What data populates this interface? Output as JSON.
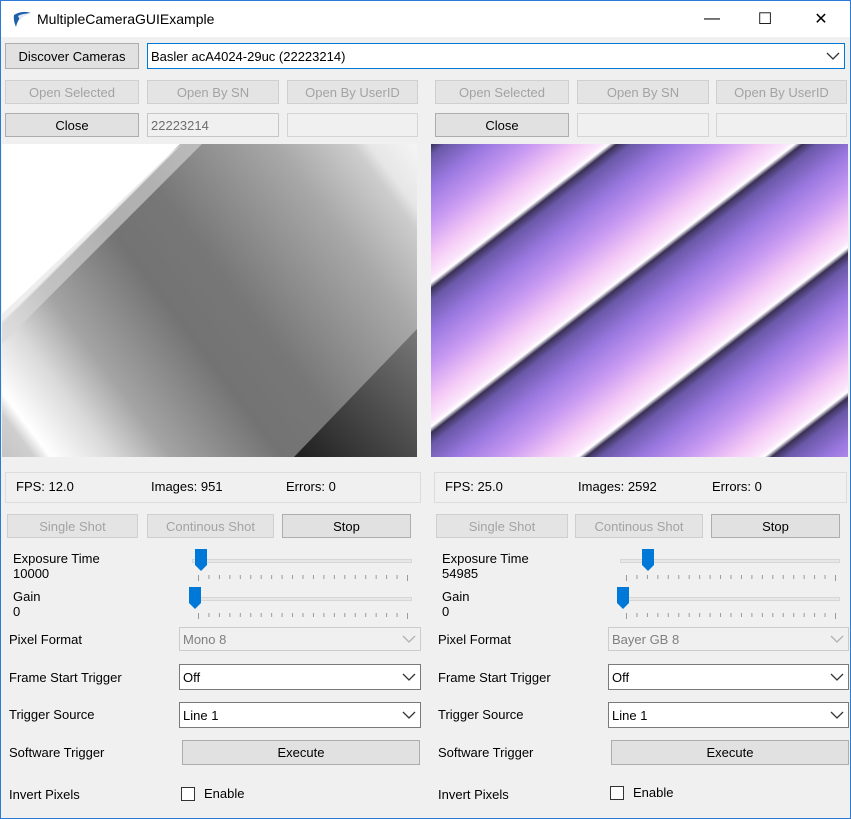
{
  "window": {
    "title": "MultipleCameraGUIExample",
    "controls": [
      "—",
      "☐",
      "✕"
    ]
  },
  "top": {
    "discover_label": "Discover Cameras",
    "camera_selected": "Basler acA4024-29uc (22223214)"
  },
  "cameras": [
    {
      "open_selected": "Open Selected",
      "open_by_sn": "Open By SN",
      "open_by_userid": "Open By UserID",
      "close": "Close",
      "sn_value": "22223214",
      "userid_value": "",
      "fps": "FPS: 12.0",
      "images": "Images: 951",
      "errors": "Errors: 0",
      "single_shot": "Single Shot",
      "continuous_shot": "Continous Shot",
      "stop": "Stop",
      "exposure_label": "Exposure Time",
      "exposure_value": "10000",
      "exposure_level": 0.03,
      "gain_label": "Gain",
      "gain_value": "0",
      "gain_level": 0.0,
      "pixel_format_label": "Pixel Format",
      "pixel_format_value": "Mono 8",
      "frame_start_label": "Frame Start Trigger",
      "frame_start_value": "Off",
      "trigger_source_label": "Trigger Source",
      "trigger_source_value": "Line 1",
      "software_trigger_label": "Software Trigger",
      "execute": "Execute",
      "invert_label": "Invert Pixels",
      "enable_label": "Enable"
    },
    {
      "open_selected": "Open Selected",
      "open_by_sn": "Open By SN",
      "open_by_userid": "Open By UserID",
      "close": "Close",
      "sn_value": "",
      "userid_value": "",
      "fps": "FPS: 25.0",
      "images": "Images: 2592",
      "errors": "Errors: 0",
      "single_shot": "Single Shot",
      "continuous_shot": "Continous Shot",
      "stop": "Stop",
      "exposure_label": "Exposure Time",
      "exposure_value": "54985",
      "exposure_level": 0.12,
      "gain_label": "Gain",
      "gain_value": "0",
      "gain_level": 0.0,
      "pixel_format_label": "Pixel Format",
      "pixel_format_value": "Bayer GB 8",
      "frame_start_label": "Frame Start Trigger",
      "frame_start_value": "Off",
      "trigger_source_label": "Trigger Source",
      "trigger_source_value": "Line 1",
      "software_trigger_label": "Software Trigger",
      "execute": "Execute",
      "invert_label": "Invert Pixels",
      "enable_label": "Enable"
    }
  ],
  "colors": {
    "accent": "#0078d7",
    "window_border": "#2b7bd6",
    "slider_thumb": "#0078d7"
  }
}
